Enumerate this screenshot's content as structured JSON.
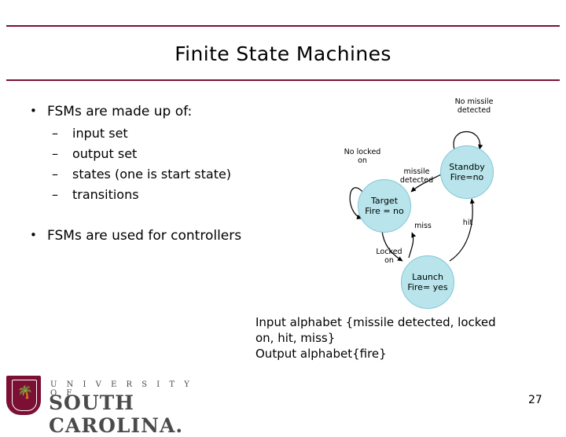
{
  "slide": {
    "title": "Finite State Machines",
    "page_number": "27"
  },
  "bullets": [
    {
      "level": 1,
      "text": "FSMs are made up of:"
    },
    {
      "level": 2,
      "text": "input set"
    },
    {
      "level": 2,
      "text": "output set"
    },
    {
      "level": 2,
      "text": "states (one is start state)"
    },
    {
      "level": 2,
      "text": "transitions"
    },
    {
      "level": 1,
      "text": "FSMs are used for controllers"
    }
  ],
  "alphabet": {
    "line1": "Input alphabet {missile detected, locked",
    "line2": "on, hit, miss}",
    "line3": "Output alphabet{fire}"
  },
  "diagram": {
    "states": [
      {
        "id": "standby",
        "line1": "Standby",
        "line2": "Fire=no"
      },
      {
        "id": "target",
        "line1": "Target",
        "line2": "Fire = no"
      },
      {
        "id": "launch",
        "line1": "Launch",
        "line2": "Fire= yes"
      }
    ],
    "labels": [
      {
        "id": "no-missile-detected",
        "text": "No missile\ndetected"
      },
      {
        "id": "no-locked-on",
        "text": "No locked\non"
      },
      {
        "id": "missile-detected",
        "text": "missile\ndetected"
      },
      {
        "id": "miss",
        "text": "miss"
      },
      {
        "id": "hit",
        "text": "hit"
      },
      {
        "id": "locked-on",
        "text": "Locked\non"
      }
    ],
    "state_fill": "#b9e4ec"
  },
  "footer": {
    "university_line": "U N I V E R S I T Y    O F",
    "name_line": "SOUTH CAROLINA."
  },
  "theme": {
    "rule_color": "#7b1034"
  }
}
